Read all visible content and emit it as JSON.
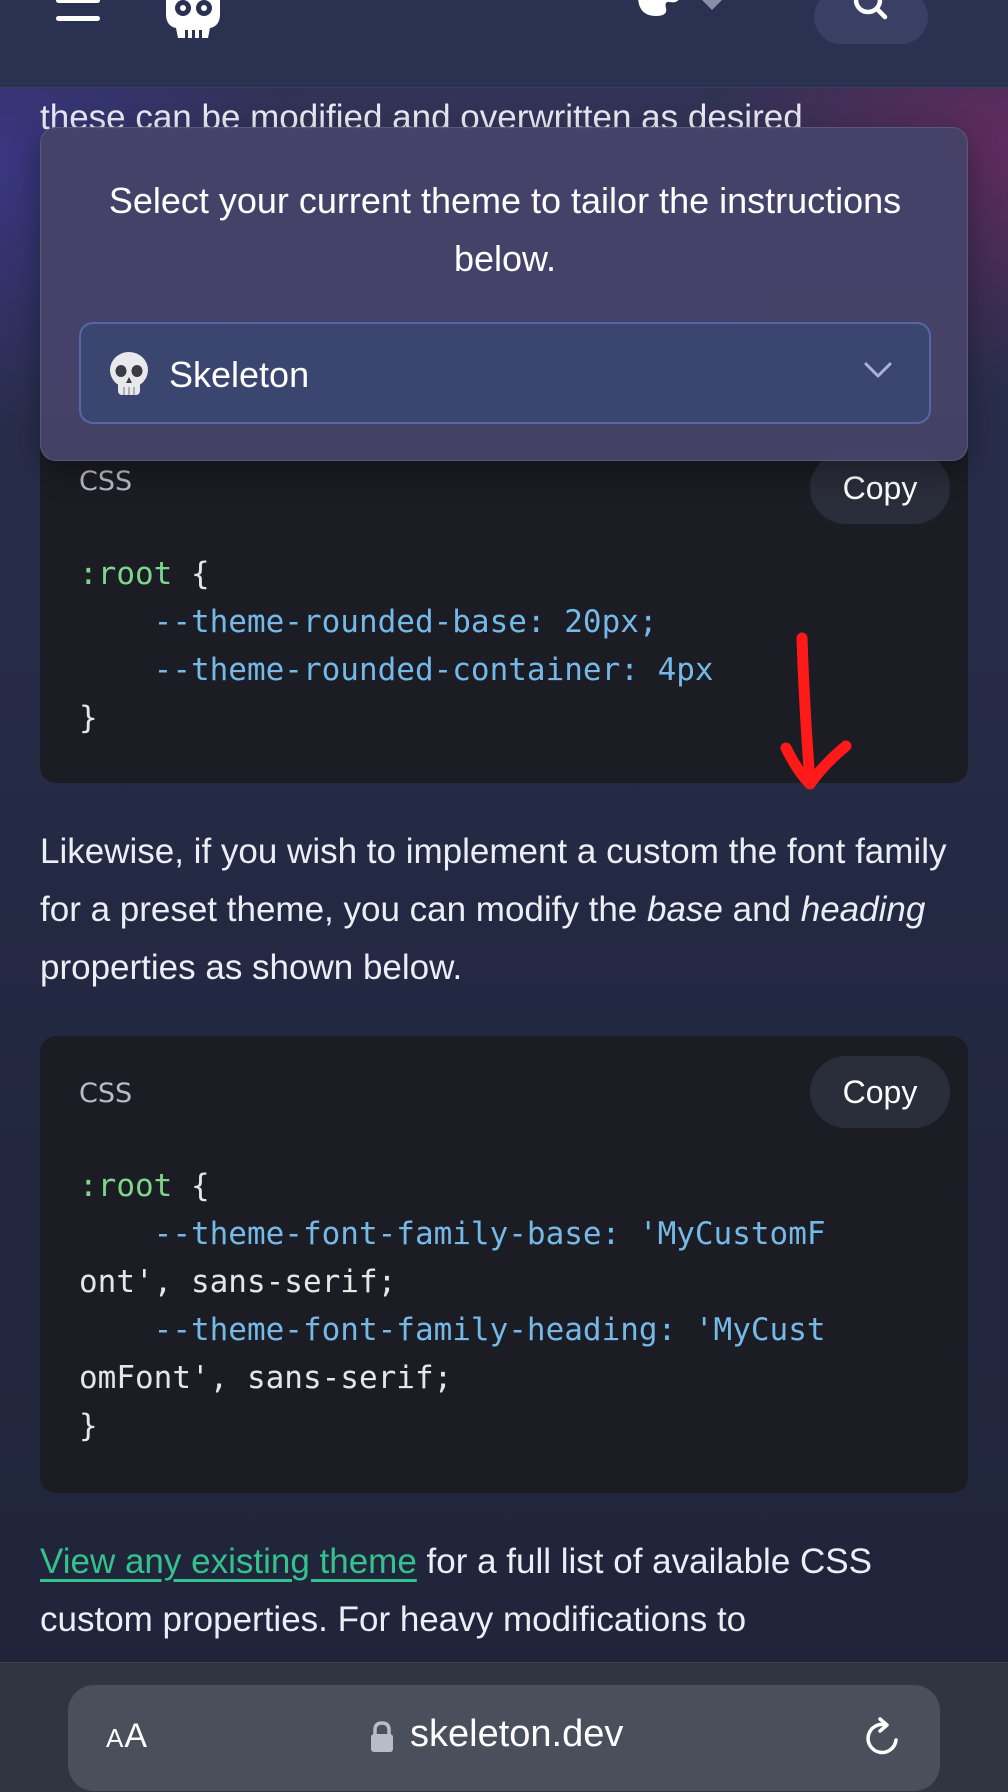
{
  "nav": {
    "icons": [
      "hamburger-icon",
      "skull-logo-icon",
      "palette-icon",
      "diamond-icon",
      "search-icon"
    ]
  },
  "content": {
    "clipped_text": "these can be modified and overwritten as desired"
  },
  "theme_popover": {
    "text": "Select your current theme to tailor the instructions below.",
    "selected_theme": "Skeleton",
    "selected_theme_icon": "skull-emoji-icon"
  },
  "code_blocks": [
    {
      "lang": "CSS",
      "copy_label": "Copy",
      "lines": [
        ":root {",
        "    --theme-rounded-base: 20px;",
        "    --theme-rounded-container: 4px",
        "}"
      ]
    },
    {
      "lang": "CSS",
      "copy_label": "Copy",
      "lines": [
        ":root {",
        "    --theme-font-family-base: 'MyCustomF",
        "ont', sans-serif;",
        "    --theme-font-family-heading: 'MyCust",
        "omFont', sans-serif;",
        "}"
      ]
    }
  ],
  "paragraph1": {
    "part1": "Likewise, if you wish to implement a custom the font family for a preset theme, you can modify the ",
    "em1": "base",
    "part2": " and ",
    "em2": "heading",
    "part3": " properties as shown below."
  },
  "paragraph2": {
    "link": "View any existing theme",
    "rest": " for a full list of available CSS custom properties. For heavy modifications to"
  },
  "browser": {
    "aa_small": "A",
    "aa_large": "A",
    "url": "skeleton.dev",
    "icons": [
      "lock-icon",
      "reload-icon"
    ]
  },
  "colors": {
    "link": "#34c28c",
    "code_selector": "#7ed68b",
    "code_property": "#74b9e8",
    "annotation_arrow": "#ff1a1a"
  }
}
